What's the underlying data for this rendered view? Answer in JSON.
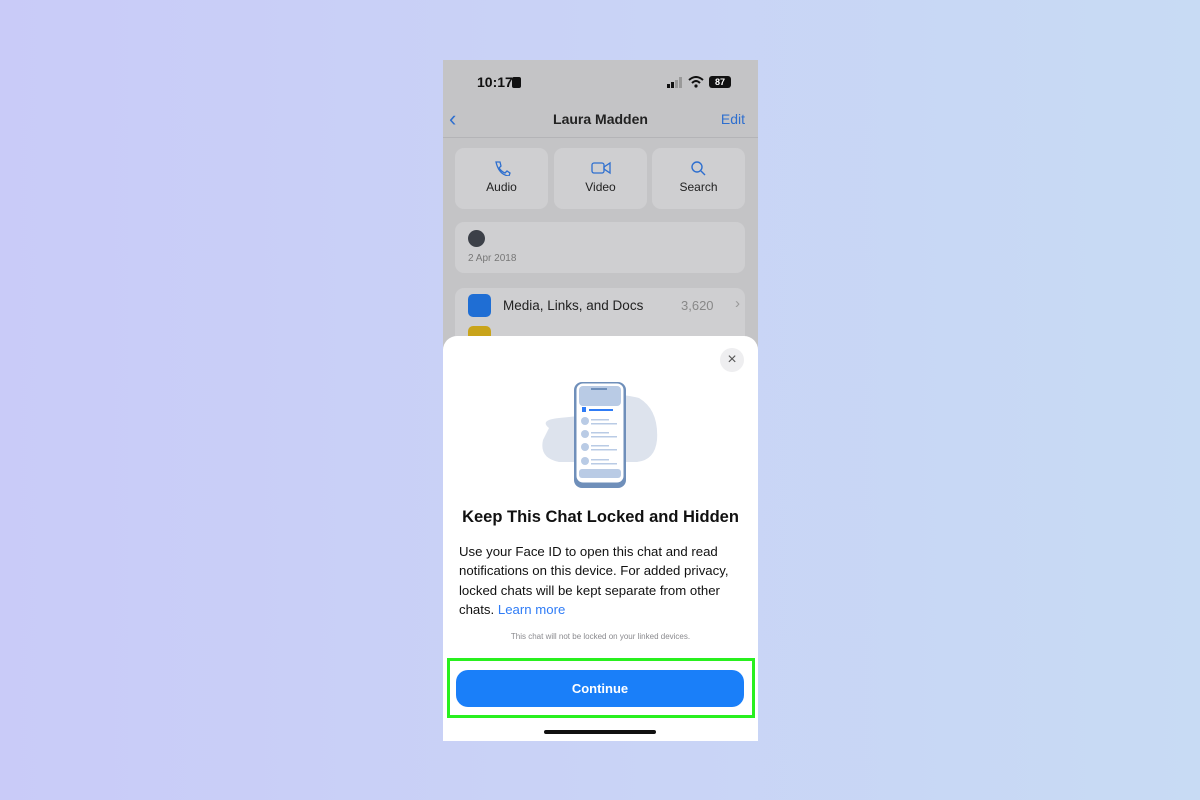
{
  "status": {
    "time": "10:17",
    "battery": "87"
  },
  "nav": {
    "title": "Laura Madden",
    "edit": "Edit"
  },
  "actions": [
    {
      "label": "Audio",
      "icon": "phone-icon"
    },
    {
      "label": "Video",
      "icon": "video-icon"
    },
    {
      "label": "Search",
      "icon": "search-icon"
    }
  ],
  "info": {
    "date": "2 Apr 2018"
  },
  "media": {
    "label": "Media, Links, and Docs",
    "count": "3,620"
  },
  "sheet": {
    "title": "Keep This Chat Locked and Hidden",
    "body": "Use your Face ID to open this chat and read notifications on this device. For added privacy, locked chats will be kept separate from other chats.",
    "learn_more": "Learn more",
    "note": "This chat will not be locked on your linked devices.",
    "continue": "Continue",
    "close": "×"
  },
  "colors": {
    "accent": "#1a7ff9",
    "highlight": "#29f01f"
  }
}
